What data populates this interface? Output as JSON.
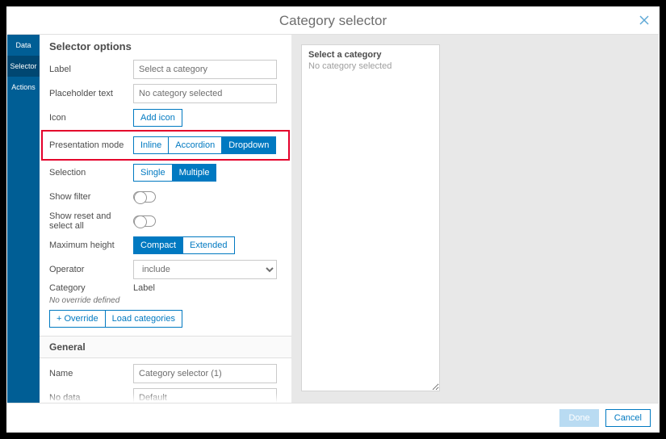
{
  "dialog_title": "Category selector",
  "side_tabs": {
    "data": "Data",
    "selector": "Selector",
    "actions": "Actions"
  },
  "panel_title": "Selector options",
  "fields": {
    "label": {
      "label": "Label",
      "value": "Select a category"
    },
    "placeholder": {
      "label": "Placeholder text",
      "value": "No category selected"
    },
    "icon": {
      "label": "Icon",
      "button": "Add icon"
    },
    "presentation": {
      "label": "Presentation mode",
      "options": {
        "inline": "Inline",
        "accordion": "Accordion",
        "dropdown": "Dropdown"
      }
    },
    "selection": {
      "label": "Selection",
      "options": {
        "single": "Single",
        "multiple": "Multiple"
      }
    },
    "show_filter": {
      "label": "Show filter"
    },
    "show_reset": {
      "label": "Show reset and select all"
    },
    "max_height": {
      "label": "Maximum height",
      "options": {
        "compact": "Compact",
        "extended": "Extended"
      }
    },
    "operator": {
      "label": "Operator",
      "value": "include"
    },
    "category_header": {
      "col1": "Category",
      "col2": "Label"
    },
    "override_note": "No override defined",
    "override_btn": "+ Override",
    "load_btn": "Load categories",
    "general_section": "General",
    "name": {
      "label": "Name",
      "value": "Category selector (1)"
    },
    "no_data": {
      "label": "No data",
      "value": "Default"
    }
  },
  "preview": {
    "title": "Select a category",
    "subtitle": "No category selected"
  },
  "footer": {
    "done": "Done",
    "cancel": "Cancel"
  }
}
